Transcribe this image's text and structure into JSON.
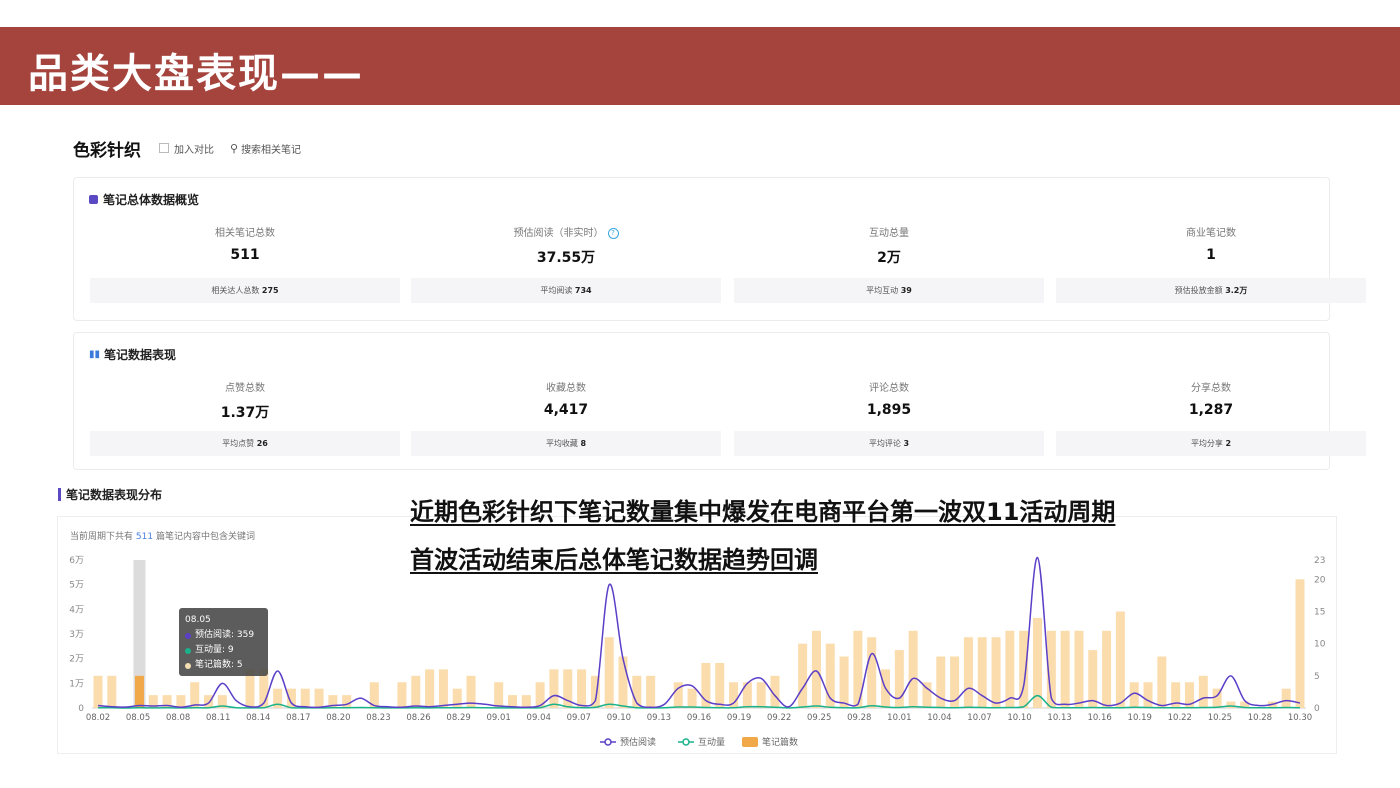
{
  "page": {
    "title": "品类大盘表现——"
  },
  "category": {
    "name": "色彩针织",
    "compare_label": "加入对比",
    "search_label": "搜索相关笔记"
  },
  "overview": {
    "title": "笔记总体数据概览",
    "metrics": [
      {
        "label": "相关笔记总数",
        "value": "511",
        "sub_label": "相关达人总数",
        "sub_value": "275"
      },
      {
        "label": "预估阅读（非实时）",
        "value": "37.55万",
        "sub_label": "平均阅读",
        "sub_value": "734"
      },
      {
        "label": "互动总量",
        "value": "2万",
        "sub_label": "平均互动",
        "sub_value": "39"
      },
      {
        "label": "商业笔记数",
        "value": "1",
        "sub_label": "预估投放金额",
        "sub_value": "3.2万"
      }
    ]
  },
  "performance": {
    "title": "笔记数据表现",
    "metrics": [
      {
        "label": "点赞总数",
        "value": "1.37万",
        "sub_label": "平均点赞",
        "sub_value": "26"
      },
      {
        "label": "收藏总数",
        "value": "4,417",
        "sub_label": "平均收藏",
        "sub_value": "8"
      },
      {
        "label": "评论总数",
        "value": "1,895",
        "sub_label": "平均评论",
        "sub_value": "3"
      },
      {
        "label": "分享总数",
        "value": "1,287",
        "sub_label": "平均分享",
        "sub_value": "2"
      }
    ]
  },
  "distribution": {
    "title": "笔记数据表现分布",
    "note_prefix": "当前周期下共有",
    "note_count": "511",
    "note_suffix": "篇笔记内容中包含关键词"
  },
  "overlay": {
    "line1": "近期色彩针织下笔记数量集中爆发在电商平台第一波双11活动周期",
    "line2": "首波活动结束后总体笔记数据趋势回调"
  },
  "tooltip": {
    "date": "08.05",
    "rows": [
      {
        "name": "预估阅读",
        "value": "359",
        "color": "#5b3fc8"
      },
      {
        "name": "互动量",
        "value": "9",
        "color": "#19b28a"
      },
      {
        "name": "笔记篇数",
        "value": "5",
        "color": "#f5deb3"
      }
    ]
  },
  "colors": {
    "title_bar": "#a5433d",
    "reads_line": "#5b3fc8",
    "interactions_line": "#19b28a",
    "bars": "#fbdcad",
    "bars_legend": "#f0a848"
  },
  "chart_data": {
    "type": "bar+line",
    "y_left_ticks": [
      "0",
      "1万",
      "2万",
      "3万",
      "4万",
      "5万",
      "6万"
    ],
    "y_left_range": [
      0,
      60000
    ],
    "y_right_ticks": [
      "0",
      "5",
      "10",
      "15",
      "20",
      "23"
    ],
    "y_right_range": [
      0,
      23
    ],
    "x_tick_labels": [
      "08.02",
      "08.05",
      "08.08",
      "08.11",
      "08.14",
      "08.17",
      "08.20",
      "08.23",
      "08.26",
      "08.29",
      "09.01",
      "09.04",
      "09.07",
      "09.10",
      "09.13",
      "09.16",
      "09.19",
      "09.22",
      "09.25",
      "09.28",
      "10.01",
      "10.04",
      "10.07",
      "10.10",
      "10.13",
      "10.16",
      "10.19",
      "10.22",
      "10.25",
      "10.28",
      "10.30"
    ],
    "highlighted_date": "08.05",
    "legend": [
      "预估阅读",
      "互动量",
      "笔记篇数"
    ],
    "series": [
      {
        "name": "笔记篇数",
        "axis": "right",
        "chart": "bar",
        "values": [
          5,
          5,
          0,
          5,
          2,
          2,
          2,
          4,
          2,
          2,
          0,
          6,
          6,
          3,
          3,
          3,
          3,
          2,
          2,
          0,
          4,
          0,
          4,
          5,
          6,
          6,
          3,
          5,
          0,
          4,
          2,
          2,
          4,
          6,
          6,
          6,
          5,
          11,
          8,
          5,
          5,
          0,
          4,
          3,
          7,
          7,
          4,
          4,
          4,
          5,
          0,
          10,
          12,
          10,
          8,
          12,
          11,
          6,
          9,
          12,
          4,
          8,
          8,
          11,
          11,
          11,
          12,
          12,
          14,
          12,
          12,
          12,
          9,
          12,
          15,
          4,
          4,
          8,
          4,
          4,
          5,
          3,
          1,
          1,
          0,
          1,
          3,
          20
        ]
      },
      {
        "name": "预估阅读",
        "axis": "left",
        "chart": "line",
        "values": [
          1000,
          500,
          359,
          1000,
          800,
          1000,
          300,
          1200,
          2000,
          10000,
          3000,
          500,
          2000,
          15000,
          2000,
          500,
          300,
          1000,
          1500,
          4000,
          1000,
          500,
          300,
          800,
          500,
          1000,
          1500,
          2000,
          1500,
          800,
          500,
          300,
          1000,
          5000,
          3000,
          1000,
          3000,
          50000,
          20000,
          2000,
          300,
          1500,
          8000,
          9000,
          3000,
          1500,
          2000,
          10000,
          12000,
          5000,
          500,
          8000,
          15000,
          4000,
          2000,
          1500,
          22000,
          8000,
          4000,
          12000,
          8000,
          4000,
          3000,
          8000,
          5000,
          2000,
          4000,
          9000,
          61000,
          4000,
          1500,
          2000,
          3000,
          1000,
          2000,
          6000,
          3000,
          1000,
          2000,
          1500,
          4000,
          5000,
          13000,
          3000,
          1000,
          1500,
          3000,
          2000
        ]
      },
      {
        "name": "互动量",
        "axis": "left",
        "chart": "line",
        "values": [
          100,
          100,
          9,
          100,
          50,
          100,
          50,
          100,
          100,
          800,
          100,
          50,
          100,
          1500,
          100,
          50,
          30,
          100,
          100,
          200,
          100,
          50,
          30,
          100,
          50,
          100,
          100,
          200,
          100,
          50,
          50,
          30,
          100,
          1500,
          500,
          100,
          300,
          1500,
          800,
          100,
          30,
          100,
          400,
          400,
          200,
          100,
          100,
          500,
          500,
          300,
          50,
          400,
          800,
          300,
          100,
          100,
          900,
          400,
          200,
          500,
          300,
          200,
          100,
          300,
          200,
          100,
          200,
          500,
          5000,
          300,
          100,
          100,
          200,
          100,
          100,
          300,
          200,
          100,
          100,
          100,
          200,
          300,
          800,
          200,
          100,
          100,
          200,
          100
        ]
      }
    ]
  }
}
